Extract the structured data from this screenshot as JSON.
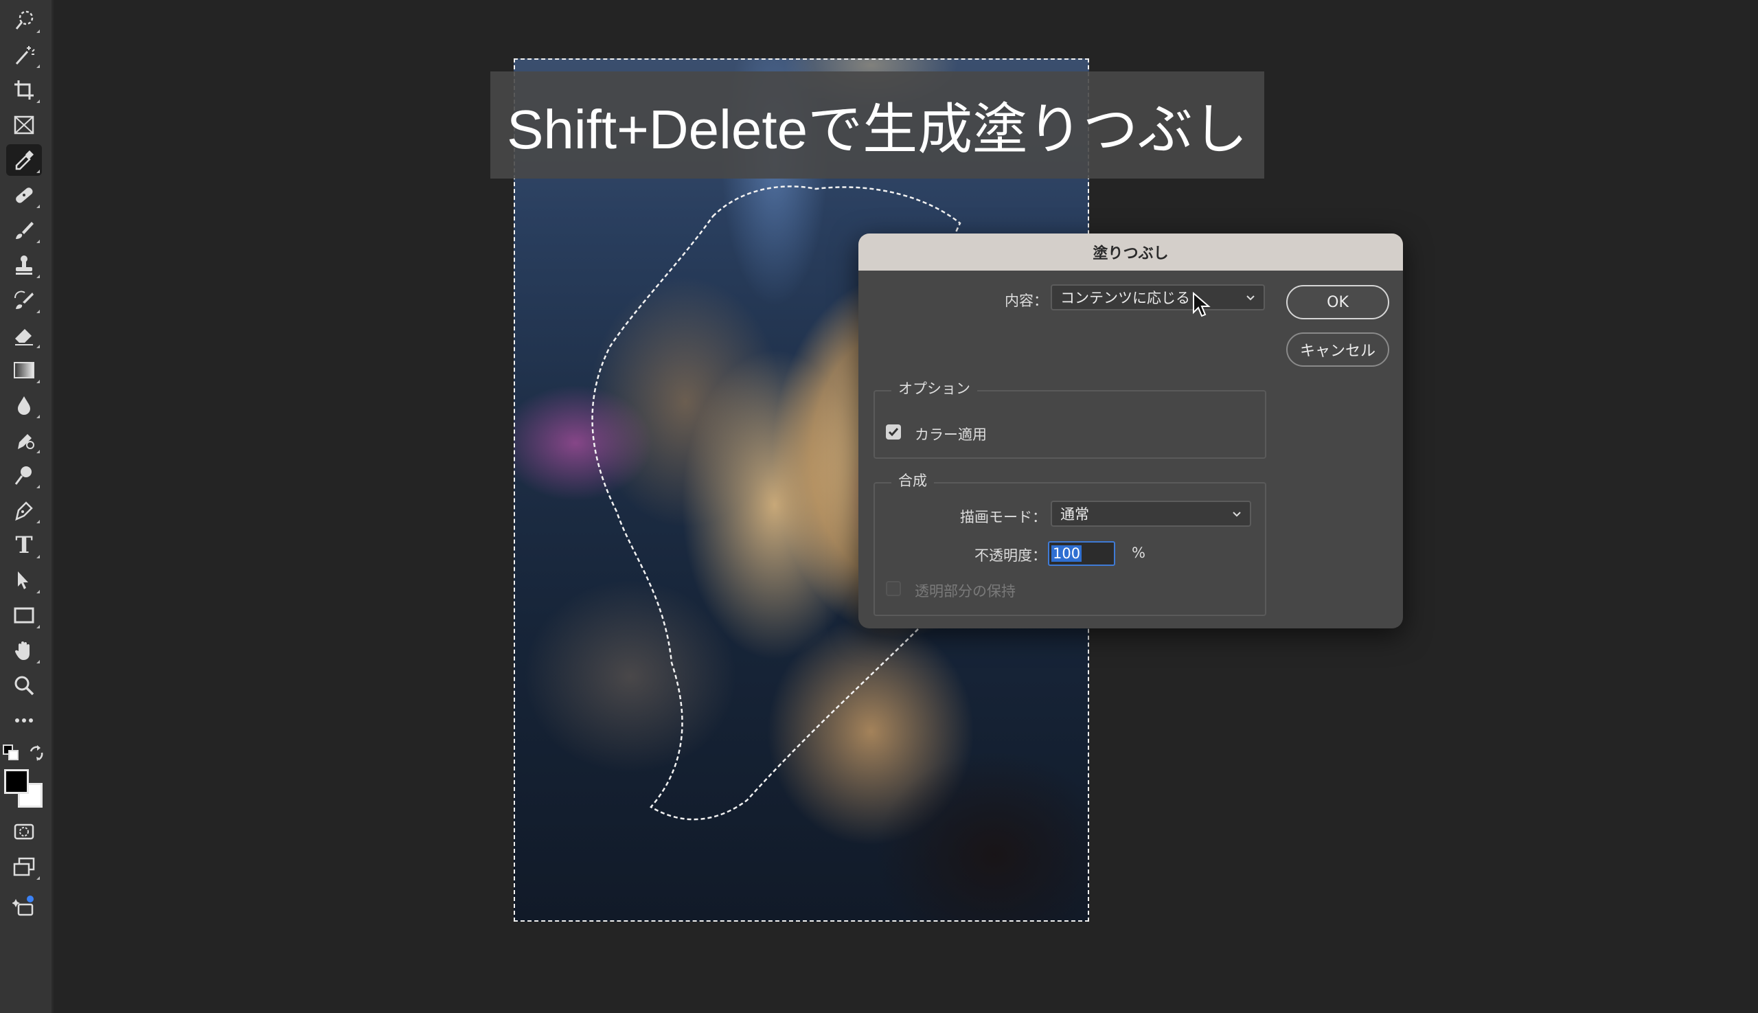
{
  "toolbar": {
    "tools": [
      "quick-selection",
      "magic-wand",
      "crop",
      "frame",
      "eyedropper",
      "spot-healing",
      "brush",
      "clone-stamp",
      "history-brush",
      "eraser",
      "gradient",
      "blur",
      "dodge",
      "smudge",
      "pen",
      "type",
      "path-selection",
      "rectangle",
      "hand",
      "zoom",
      "more",
      "quick-mask",
      "screen-mode",
      "generative"
    ],
    "type_tool_glyph": "T",
    "foreground_color": "#000000",
    "background_color": "#ffffff"
  },
  "caption": {
    "text": "Shift+Deleteで生成塗りつぶし"
  },
  "dialog": {
    "title": "塗りつぶし",
    "contents_label": "内容：",
    "contents_value": "コンテンツに応じる",
    "ok_label": "OK",
    "cancel_label": "キャンセル",
    "options_title": "オプション",
    "color_adapt_label": "カラー適用",
    "color_adapt_checked": true,
    "blending_title": "合成",
    "mode_label": "描画モード：",
    "mode_value": "通常",
    "opacity_label": "不透明度：",
    "opacity_value": "100",
    "opacity_unit": "%",
    "preserve_transparency_label": "透明部分の保持",
    "preserve_transparency_checked": false
  }
}
